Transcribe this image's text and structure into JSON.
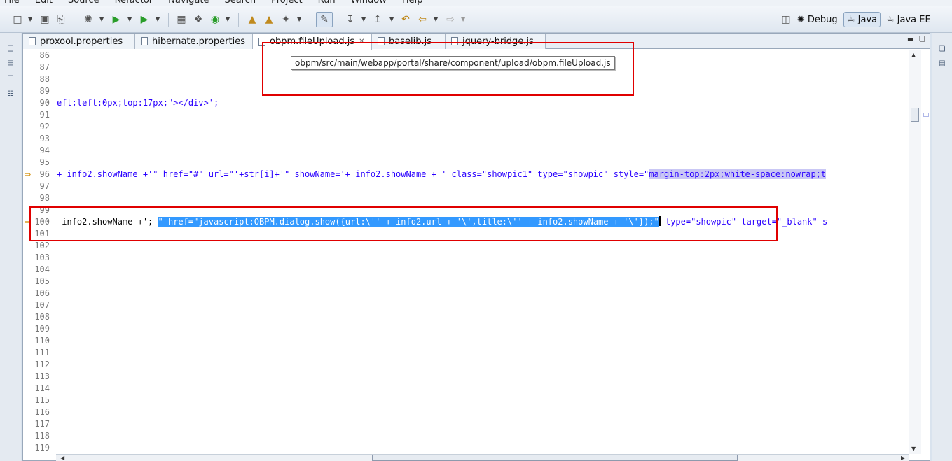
{
  "menu": [
    "File",
    "Edit",
    "Source",
    "Refactor",
    "Navigate",
    "Search",
    "Project",
    "Run",
    "Window",
    "Help"
  ],
  "toolbar": {
    "perspectives": [
      {
        "label": "Debug",
        "icon": "debug-perspective-icon",
        "active": false
      },
      {
        "label": "Java",
        "icon": "java-perspective-icon",
        "active": true
      },
      {
        "label": "Java EE",
        "icon": "javaee-perspective-icon",
        "active": false
      }
    ],
    "icons": [
      "new-icon",
      "save-icon",
      "print-icon",
      "debug-icon",
      "run-icon",
      "external-tools-icon",
      "new-java-project-icon",
      "new-package-icon",
      "new-class-icon",
      "open-type-icon",
      "open-task-icon",
      "search-icon",
      "toggle-mark-occurrences-icon",
      "next-annotation-icon",
      "previous-annotation-icon",
      "last-edit-location-icon",
      "back-icon",
      "forward-icon"
    ]
  },
  "tabs": [
    {
      "label": "proxool.properties",
      "active": false
    },
    {
      "label": "hibernate.properties",
      "active": false
    },
    {
      "label": "obpm.fileUpload.js",
      "active": true
    },
    {
      "label": "baselib.js",
      "active": false
    },
    {
      "label": "jquery-bridge.js",
      "active": false
    }
  ],
  "tooltip": "obpm/src/main/webapp/portal/share/component/upload/obpm.fileUpload.js",
  "line_numbers": [
    "86",
    "87",
    "88",
    "89",
    "90",
    "91",
    "92",
    "93",
    "94",
    "95",
    "96",
    "97",
    "98",
    "99",
    "100",
    "101",
    "102",
    "103",
    "104",
    "105",
    "106",
    "107",
    "108",
    "109",
    "110",
    "111",
    "112",
    "113",
    "114",
    "115",
    "116",
    "117",
    "118",
    "119"
  ],
  "code": {
    "line90": {
      "plain": "eft;left:0px;top:17px;\"></div>';"
    },
    "line96": {
      "part1": "+ info2.showName +'\" href=\"#\" url=\"'+str[i]+'\" showName='+ info2.showName + ' class=\"showpic1\" type=\"showpic\" style=\"",
      "part2": "margin-top:2px;white-space:nowrap;t"
    },
    "line100": {
      "part1": " info2.showName +'; ",
      "selected": "\" href=\"javascript:OBPM.dialog.show({url:\\'' + info2.url + '\\',title:\\'' + info2.showName + '\\'});\"",
      "part2": " type=\"showpic\" target=\"_blank\" s"
    }
  }
}
